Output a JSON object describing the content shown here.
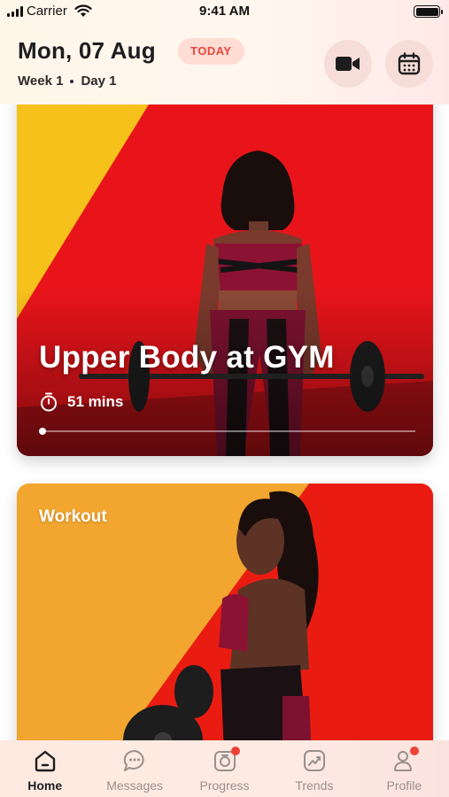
{
  "status_bar": {
    "carrier": "Carrier",
    "time": "9:41 AM"
  },
  "header": {
    "date": "Mon, 07 Aug",
    "badge": "TODAY",
    "week": "Week 1",
    "day": "Day 1"
  },
  "featured": {
    "title": "Upper Body at GYM",
    "duration": "51 mins",
    "progress": 0.01
  },
  "second_card": {
    "label": "Workout"
  },
  "tabs": [
    {
      "label": "Home",
      "icon": "home-icon",
      "active": true,
      "badge": false
    },
    {
      "label": "Messages",
      "icon": "chat-icon",
      "active": false,
      "badge": false
    },
    {
      "label": "Progress",
      "icon": "progress-photo-icon",
      "active": false,
      "badge": true
    },
    {
      "label": "Trends",
      "icon": "trends-icon",
      "active": false,
      "badge": false
    },
    {
      "label": "Profile",
      "icon": "profile-icon",
      "active": false,
      "badge": true
    }
  ],
  "colors": {
    "accent": "#e8453a",
    "badge_bg": "#ffdcd4",
    "notification": "#ef4136",
    "card1_red": "#e8141a",
    "card1_yellow": "#f7c11c",
    "card2_orange": "#f2a62f"
  }
}
